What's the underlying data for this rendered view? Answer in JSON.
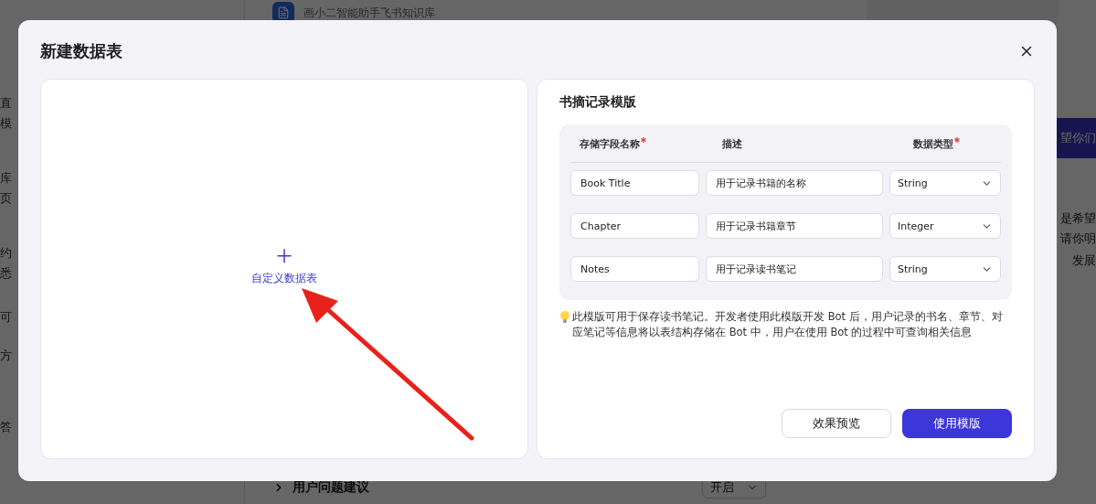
{
  "background": {
    "left_fragments": [
      {
        "text": "直"
      },
      {
        "text": "模"
      },
      {
        "text": "库"
      },
      {
        "text": "页"
      },
      {
        "text": "约"
      },
      {
        "text": "悉"
      },
      {
        "text": "可"
      },
      {
        "text": "方"
      },
      {
        "text": "答"
      }
    ],
    "knowledge_base": {
      "description": "画小二智能助手飞书知识库"
    },
    "setting": {
      "label": "用户问题建议",
      "value": "开启"
    },
    "chat_fragments": [
      {
        "kind": "highlight",
        "text": "望你们"
      },
      {
        "kind": "plain",
        "text": "是希望"
      },
      {
        "kind": "plain",
        "text": "请你明"
      },
      {
        "kind": "plain",
        "text": "发展"
      }
    ]
  },
  "dialog": {
    "title": "新建数据表",
    "custom_card": {
      "label": "自定义数据表"
    },
    "template": {
      "title": "书摘记录模版",
      "columns": [
        {
          "label": "存储字段名称",
          "required": true
        },
        {
          "label": "描述",
          "required": false
        },
        {
          "label": "数据类型",
          "required": true
        }
      ],
      "rows": [
        {
          "name": "Book Title",
          "description": "用于记录书籍的名称",
          "type": "String"
        },
        {
          "name": "Chapter",
          "description": "用于记录书籍章节",
          "type": "Integer"
        },
        {
          "name": "Notes",
          "description": "用于记录读书笔记",
          "type": "String"
        }
      ],
      "note": "此模版可用于保存读书笔记。开发者使用此模版开发 Bot 后，用户记录的书名、章节、对应笔记等信息将以表结构存储在 Bot 中，用户在使用 Bot 的过程中可查询相关信息",
      "buttons": [
        {
          "label": "效果预览",
          "kind": "secondary"
        },
        {
          "label": "使用模版",
          "kind": "primary"
        }
      ]
    }
  }
}
